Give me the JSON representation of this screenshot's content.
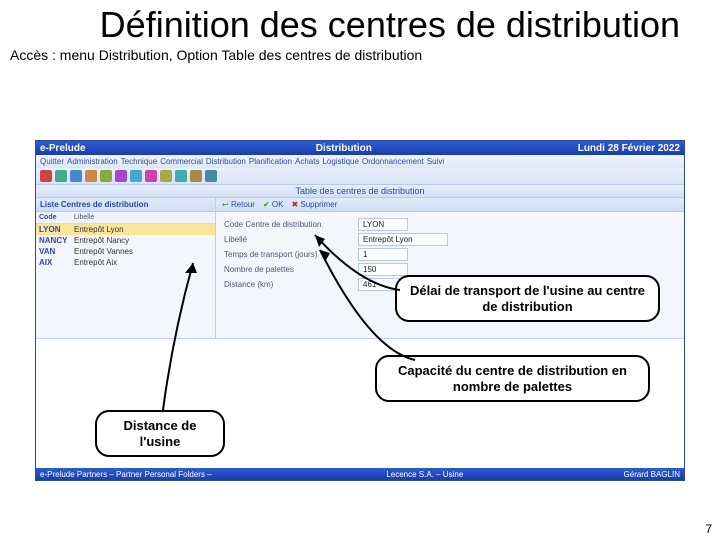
{
  "slide": {
    "title": "Définition des centres de distribution",
    "access_prefix": "Accès : menu ",
    "access_path": "Distribution, Option Table des centres de distribution"
  },
  "app": {
    "brand": "e-Prelude",
    "module": "Distribution",
    "date": "Lundi 28 Février 2022",
    "menu": [
      "Quitter",
      "Administration",
      "Technique",
      "Commercial",
      "Distribution",
      "Planification",
      "Achats",
      "Logistique",
      "Ordonnancement",
      "Suivi"
    ],
    "subtitle": "Table des centres de distribution",
    "list_header": "Liste Centres de distribution",
    "grid_cols": {
      "code": "Code",
      "lib": "Libellé"
    },
    "rows": [
      {
        "code": "LYON",
        "lib": "Entrepôt Lyon"
      },
      {
        "code": "NANCY",
        "lib": "Entrepôt Nancy"
      },
      {
        "code": "VAN",
        "lib": "Entrepôt Vannes"
      },
      {
        "code": "AIX",
        "lib": "Entrepôt Aix"
      }
    ],
    "toolbar": {
      "ret": "Retour",
      "ok": "OK",
      "del": "Supprimer"
    },
    "form": {
      "label_code": "Code Centre de distribution",
      "val_code": "LYON",
      "label_lib": "Libellé",
      "val_lib": "Entrepôt Lyon",
      "label_delay": "Temps de transport (jours)",
      "val_delay": "1",
      "label_cap": "Nombre de palettes",
      "val_cap": "150",
      "label_dist": "Distance (km)",
      "val_dist": "461"
    },
    "footer_left": "e-Prelude Partners – Partner Personal Folders –",
    "footer_mid": "Lecence S.A. – Usine",
    "footer_right": "Gérard BAGLIN"
  },
  "callouts": {
    "delay": "Délai de transport de l'usine au centre de distribution",
    "capacity": "Capacité du centre de distribution en nombre de palettes",
    "distance": "Distance de l'usine"
  },
  "toolbar_icon_colors": [
    "#c44",
    "#4a8",
    "#48c",
    "#c84",
    "#8a4",
    "#a4c",
    "#4ac",
    "#c4a",
    "#aa4",
    "#4aa",
    "#a84",
    "#48a"
  ],
  "page_number": "7"
}
